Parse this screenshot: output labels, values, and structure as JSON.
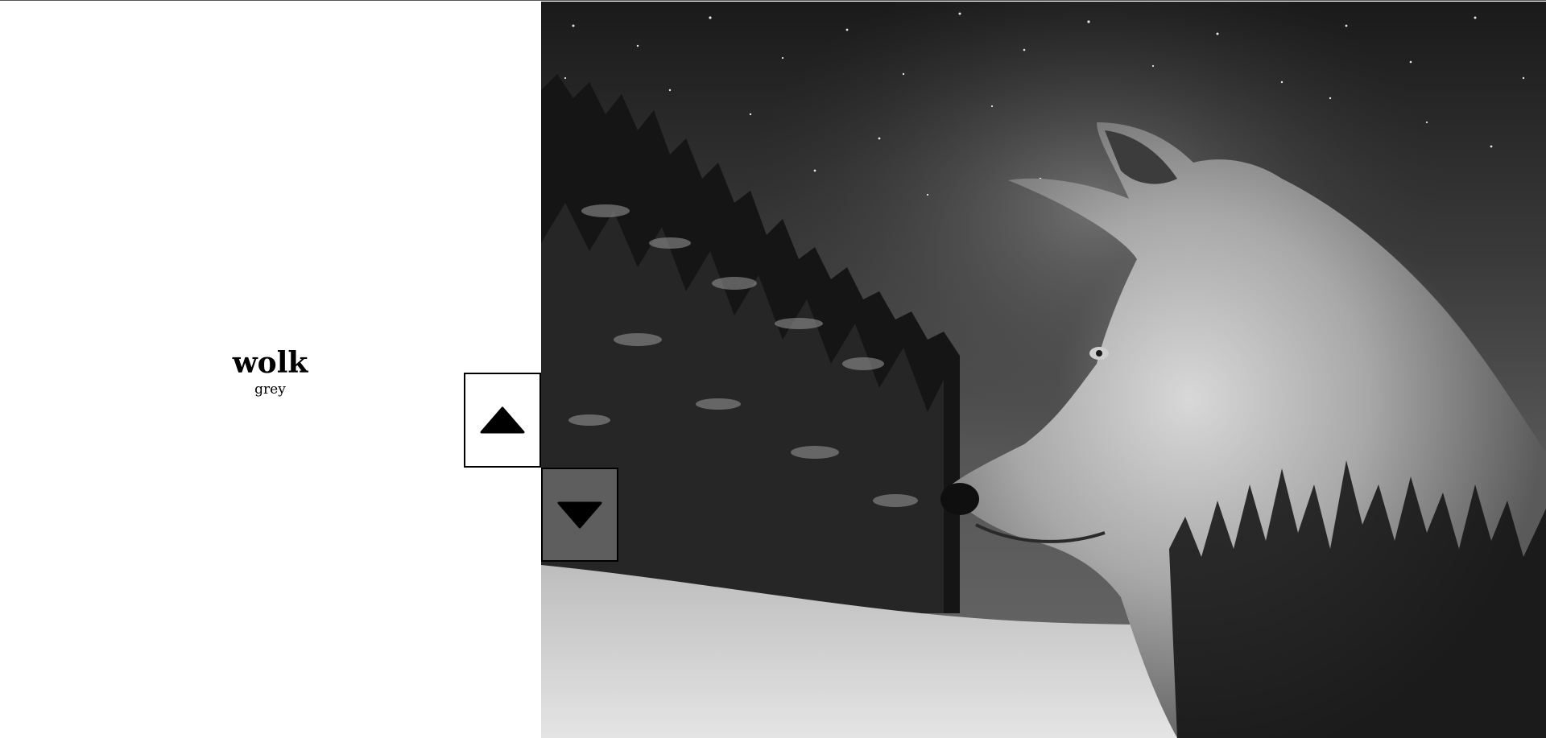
{
  "caption": {
    "title": "wolk",
    "subtitle": "grey"
  },
  "slider": {
    "image_icon": "wolf-forest-double-exposure-image",
    "up_icon": "triangle-up-icon",
    "down_icon": "triangle-down-icon"
  },
  "colors": {
    "background": "#ffffff",
    "text": "#000000",
    "button_border": "#000000",
    "down_button_fill": "#8c8c8c"
  }
}
